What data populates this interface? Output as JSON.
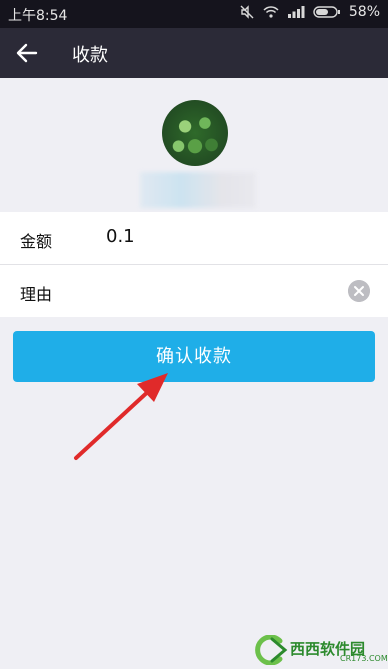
{
  "status_bar": {
    "time": "上午8:54",
    "battery": "58%"
  },
  "header": {
    "title": "收款"
  },
  "form": {
    "amount_label": "金额",
    "amount_value": "0.1",
    "reason_label": "理由",
    "reason_value": ""
  },
  "actions": {
    "confirm_label": "确认收款"
  },
  "watermark": {
    "brand": "西西软件园",
    "url": "CR173.COM"
  },
  "colors": {
    "accent": "#1faee8",
    "navbar": "#2b2a37",
    "statusbar": "#15141d",
    "arrow": "#e02a2a"
  }
}
